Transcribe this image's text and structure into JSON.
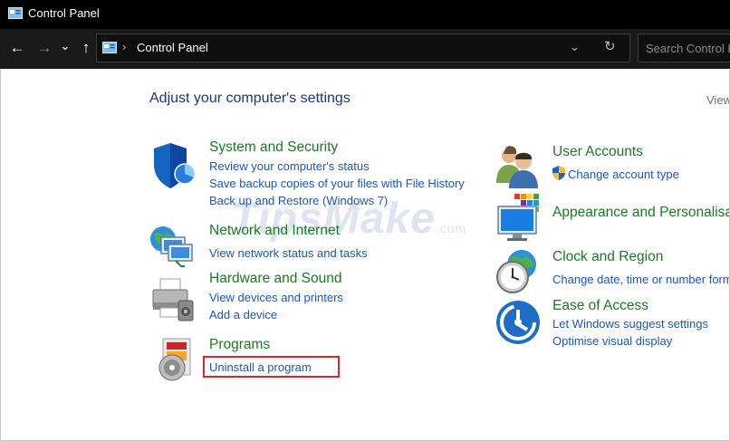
{
  "window": {
    "title": "Control Panel"
  },
  "nav": {
    "back_glyph": "←",
    "forward_glyph": "→",
    "recent_glyph": "⌄",
    "up_glyph": "↑",
    "address_separator": "›",
    "address_crumb": "Control Panel",
    "dropdown_glyph": "⌄",
    "refresh_glyph": "↻"
  },
  "search": {
    "placeholder": "Search Control Panel"
  },
  "main": {
    "title": "Adjust your computer's settings",
    "view_by": "View by:"
  },
  "categories_left": [
    {
      "icon": "shield-icon",
      "title": "System and Security",
      "links": [
        "Review your computer's status",
        "Save backup copies of your files with File History",
        "Back up and Restore (Windows 7)"
      ]
    },
    {
      "icon": "network-icon",
      "title": "Network and Internet",
      "links": [
        "View network status and tasks"
      ]
    },
    {
      "icon": "printer-icon",
      "title": "Hardware and Sound",
      "links": [
        "View devices and printers",
        "Add a device"
      ]
    },
    {
      "icon": "programs-disc-icon",
      "title": "Programs",
      "links": [
        "Uninstall a program"
      ]
    }
  ],
  "categories_right": [
    {
      "icon": "user-accounts-icon",
      "title": "User Accounts",
      "links": [
        "Change account type"
      ],
      "link_icon": "uac-shield-icon"
    },
    {
      "icon": "appearance-icon",
      "title": "Appearance and Personalisation",
      "links": []
    },
    {
      "icon": "clock-globe-icon",
      "title": "Clock and Region",
      "links": [
        "Change date, time or number formats"
      ]
    },
    {
      "icon": "ease-of-access-icon",
      "title": "Ease of Access",
      "links": [
        "Let Windows suggest settings",
        "Optimise visual display"
      ]
    }
  ],
  "watermark": {
    "brand": "TipsMake",
    "tld": ".com"
  },
  "colors": {
    "title_bar": "#000000",
    "nav_bar": "#191919",
    "page_title": "#1e3287",
    "category_title": "#1a7a22",
    "link": "#1a55c4",
    "highlight": "#e0242b"
  }
}
